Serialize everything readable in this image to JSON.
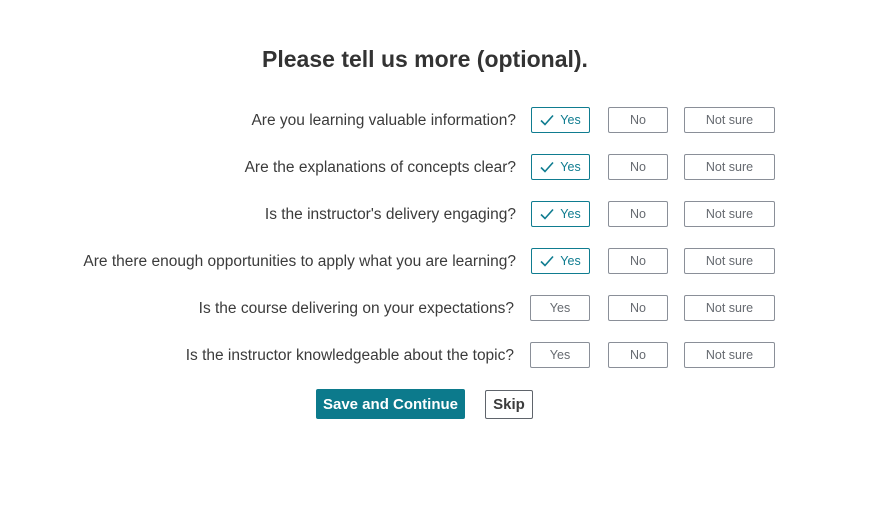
{
  "title": "Please tell us more (optional).",
  "options": {
    "yes": "Yes",
    "no": "No",
    "not_sure": "Not sure"
  },
  "questions": [
    {
      "text": "Are you learning valuable information?",
      "selected": "yes"
    },
    {
      "text": "Are the explanations of concepts clear?",
      "selected": "yes"
    },
    {
      "text": "Is the instructor's delivery engaging?",
      "selected": "yes"
    },
    {
      "text": "Are there enough opportunities to apply what you are learning?",
      "selected": "yes"
    },
    {
      "text": "Is the course delivering on your expectations?",
      "selected": ""
    },
    {
      "text": "Is the instructor knowledgeable about the topic?",
      "selected": ""
    }
  ],
  "actions": {
    "save_label": "Save and Continue",
    "skip_label": "Skip"
  },
  "colors": {
    "accent": "#0c7a8c",
    "selected_border": "#0f7c90"
  }
}
